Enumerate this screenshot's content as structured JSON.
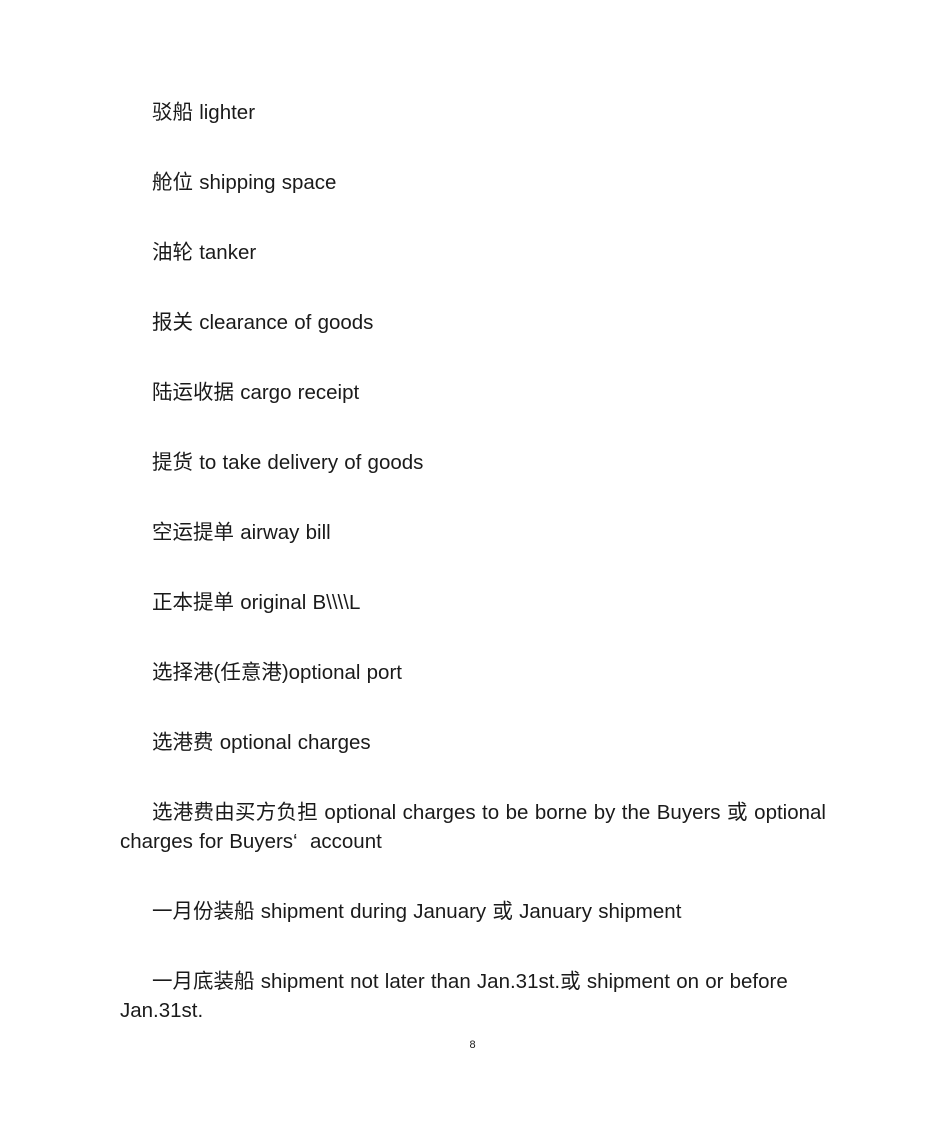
{
  "document": {
    "page_number": "8",
    "text_color": "#1a1a1a",
    "background_color": "#ffffff",
    "entries": [
      {
        "text": "驳船 lighter"
      },
      {
        "text": "舱位 shipping space"
      },
      {
        "text": "油轮 tanker"
      },
      {
        "text": "报关 clearance of goods"
      },
      {
        "text": "陆运收据 cargo receipt"
      },
      {
        "text": "提货 to take delivery of goods"
      },
      {
        "text": "空运提单 airway bill"
      },
      {
        "text": "正本提单 original B\\\\\\\\L"
      },
      {
        "text": "选择港(任意港)optional port"
      },
      {
        "text": "选港费 optional charges"
      },
      {
        "text": "选港费由买方负担 optional charges to be borne by the Buyers 或 optional charges for Buyers‘  account",
        "justified": true
      },
      {
        "text": "一月份装船 shipment during January 或 January shipment"
      },
      {
        "text": "一月底装船 shipment not later than Jan.31st.或 shipment on or before Jan.31st."
      }
    ]
  }
}
